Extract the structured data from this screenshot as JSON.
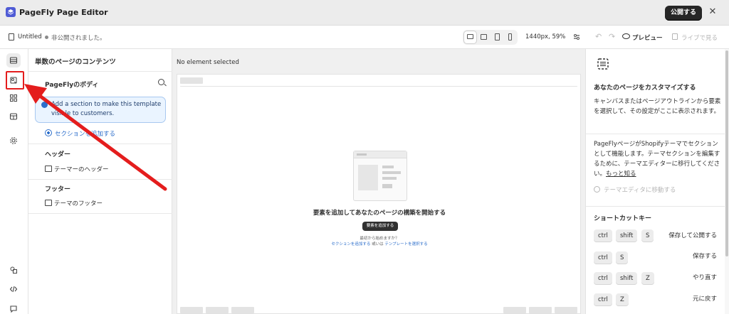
{
  "titlebar": {
    "app_title": "PageFly Page Editor",
    "publish_label": "公開する",
    "close_symbol": "✕"
  },
  "toolbar": {
    "doc_name": "Untitled",
    "doc_status": "非公開されました。",
    "viewport_label": "1440px, 59%",
    "undo_symbol": "↶",
    "redo_symbol": "↷",
    "preview_label": "プレビュー",
    "live_label": "ライブで見る"
  },
  "rail": {
    "icons": [
      "layers-icon",
      "page-elements-icon",
      "apps-grid-icon",
      "box-icon",
      "settings-icon",
      "shapes-icon",
      "code-icon",
      "chat-icon"
    ],
    "highlight_color": "#e41d1d"
  },
  "left_panel": {
    "title": "単数のページのコンテンツ",
    "body_label": "PageFlyのボディ",
    "info_text": "Add a section to make this template visible to customers.",
    "add_section": "セクションを追加する",
    "header_heading": "ヘッダー",
    "header_item": "テーマーのヘッダー",
    "footer_heading": "フッター",
    "footer_item": "テーマのフッター"
  },
  "canvas": {
    "no_selection": "No element selected",
    "empty_title": "要素を追加してあなたのページの構築を開始する",
    "empty_button": "要素を追加する",
    "empty_question": "最初から始めますか？",
    "link_add_section": "セクションを追加する",
    "link_or": "或いは",
    "link_template": "テンプレートを選択する"
  },
  "right_panel": {
    "title": "あなたのページをカスタマイズする",
    "description": "キャンバスまたはページアウトラインから要素を選択して、その設定がここに表示されます。",
    "theme_info": "PageFlyページがShopifyテーマでセクションとして機能します。テーマセクションを編集するために、テーマエディターに移行してください。",
    "learn_more": "もっと知る",
    "move_to_editor": "テーマエディタに移動する",
    "shortcuts_title": "ショートカットキー",
    "shortcuts": [
      {
        "keys": [
          "ctrl",
          "shift",
          "S"
        ],
        "desc": "保存して公開する"
      },
      {
        "keys": [
          "ctrl",
          "S"
        ],
        "desc": "保存する"
      },
      {
        "keys": [
          "ctrl",
          "shift",
          "Z"
        ],
        "desc": "やり直す"
      },
      {
        "keys": [
          "ctrl",
          "Z"
        ],
        "desc": "元に戻す"
      }
    ]
  },
  "colors": {
    "accent_blue": "#2c6ecb",
    "annotation_red": "#e41d1d",
    "brand": "#4f5bd5"
  }
}
